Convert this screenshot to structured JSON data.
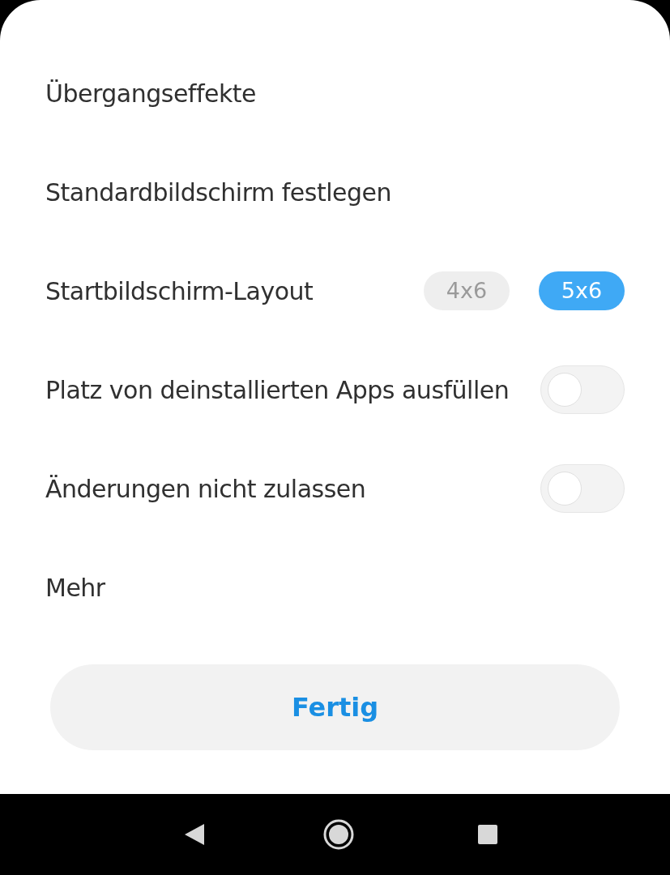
{
  "settings": [
    {
      "kind": "plain",
      "label": "Übergangseffekte"
    },
    {
      "kind": "plain",
      "label": "Standardbildschirm festlegen"
    },
    {
      "kind": "segmented",
      "label": "Startbildschirm-Layout",
      "options": [
        {
          "label": "4x6",
          "selected": false
        },
        {
          "label": "5x6",
          "selected": true
        }
      ]
    },
    {
      "kind": "toggle",
      "label": "Platz von deinstallierten Apps ausfüllen",
      "on": false
    },
    {
      "kind": "toggle",
      "label": "Änderungen nicht zulassen",
      "on": false
    },
    {
      "kind": "plain",
      "label": "Mehr"
    }
  ],
  "done_button": {
    "label": "Fertig"
  }
}
